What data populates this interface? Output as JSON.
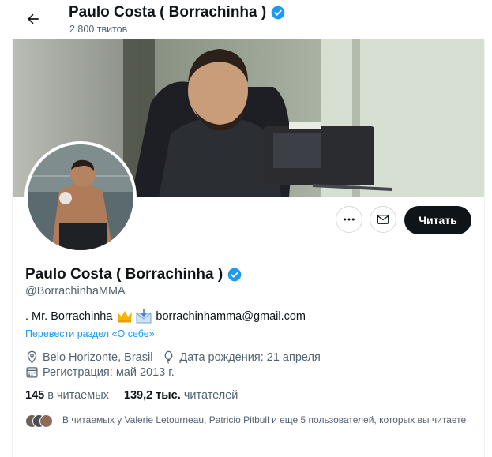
{
  "header": {
    "name": "Paulo Costa ( Borrachinha )",
    "tweet_count": "2 800 твитов"
  },
  "profile": {
    "name": "Paulo Costa ( Borrachinha )",
    "handle": "@BorrachinhaMMA",
    "bio_prefix": ". Mr. Borrachinha",
    "bio_email": "borrachinhamma@gmail.com",
    "translate_link": "Перевести раздел «О себе»",
    "location": "Belo Horizonte, Brasil",
    "birthday": "Дата рождения: 21 апреля",
    "joined": "Регистрация: май 2013 г.",
    "following_count": "145",
    "following_label": "в читаемых",
    "followers_count": "139,2 тыс.",
    "followers_label": "читателей",
    "mutual_text": "В читаемых у Valerie Letourneau, Patricio Pitbull и еще 5 пользователей, которых вы читаете"
  },
  "actions": {
    "follow_label": "Читать"
  },
  "icons": {
    "back": "back-arrow-icon",
    "verified": "verified-badge-icon",
    "more": "more-icon",
    "message": "message-icon",
    "location": "location-icon",
    "birthday": "balloon-icon",
    "calendar": "calendar-icon",
    "crown": "crown-emoji",
    "envelope": "envelope-emoji"
  },
  "colors": {
    "verified": "#1d9bf0",
    "link": "#1d9bf0",
    "text_secondary": "#536471",
    "follow_bg": "#0f1419"
  }
}
